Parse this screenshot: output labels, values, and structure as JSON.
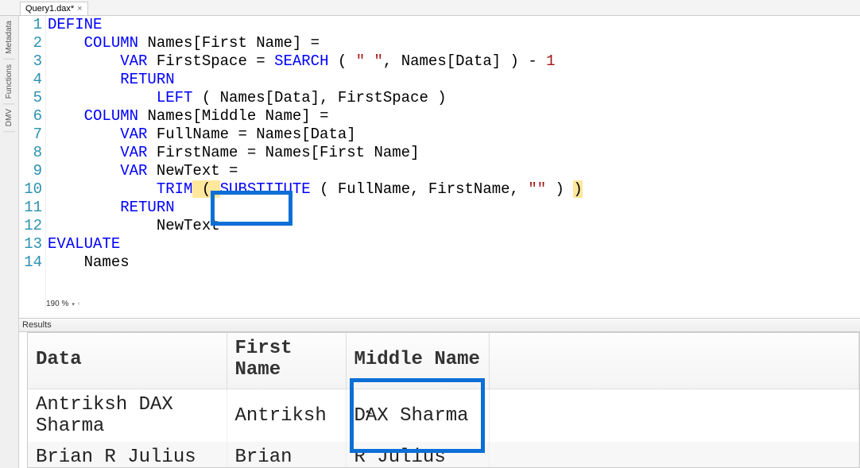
{
  "tab": {
    "title": "Query1.dax*",
    "close": "×"
  },
  "gutter": {
    "metadata": "Metadata",
    "functions": "Functions",
    "dmv": "DMV"
  },
  "zoom": {
    "value": "190 %",
    "chev": "▾",
    "tick": "‹"
  },
  "code": {
    "l1_kw": "DEFINE",
    "l2_kw": "COLUMN ",
    "l2_txt": "Names[First Name] = ",
    "l3_kw": "VAR ",
    "l3_txt1": "FirstSpace = ",
    "l3_fn": "SEARCH",
    "l3_txt2": " ( ",
    "l3_str": "\" \"",
    "l3_txt3": ", Names[Data] ) - ",
    "l3_num": "1",
    "l4_kw": "RETURN",
    "l5_fn": "LEFT",
    "l5_txt": " ( Names[Data], FirstSpace )",
    "l6_kw": "COLUMN ",
    "l6_txt": "Names[Middle Name] = ",
    "l7_kw": "VAR ",
    "l7_txt": "FullName = Names[Data]",
    "l8_kw": "VAR ",
    "l8_txt": "FirstName = Names[First Name]",
    "l9_kw": "VAR ",
    "l9_txt": "NewText = ",
    "l10_fn1": "TRIM",
    "l10_p1": " ( ",
    "l10_fn2": "SUBSTITUTE",
    "l10_txt": " ( FullName, FirstName, ",
    "l10_str": "\"\"",
    "l10_txt2": " ) ",
    "l10_p2": ")",
    "l11_kw": "RETURN",
    "l12_txt": "NewText",
    "l13_kw": "EVALUATE",
    "l14_txt": "Names"
  },
  "lines": [
    "1",
    "2",
    "3",
    "4",
    "5",
    "6",
    "7",
    "8",
    "9",
    "10",
    "11",
    "12",
    "13",
    "14"
  ],
  "results": {
    "label": "Results",
    "headers": {
      "data": "Data",
      "first": "First Name",
      "middle": "Middle Name"
    },
    "rows": [
      {
        "data": "Antriksh DAX Sharma",
        "first": "Antriksh",
        "middle": "DAX Sharma"
      },
      {
        "data": "Brian R Julius",
        "first": "Brian",
        "middle": "R Julius"
      }
    ]
  },
  "chart_data": {
    "type": "table",
    "columns": [
      "Data",
      "First Name",
      "Middle Name"
    ],
    "rows": [
      [
        "Antriksh DAX Sharma",
        "Antriksh",
        "DAX Sharma"
      ],
      [
        "Brian R Julius",
        "Brian",
        "R Julius"
      ]
    ]
  }
}
